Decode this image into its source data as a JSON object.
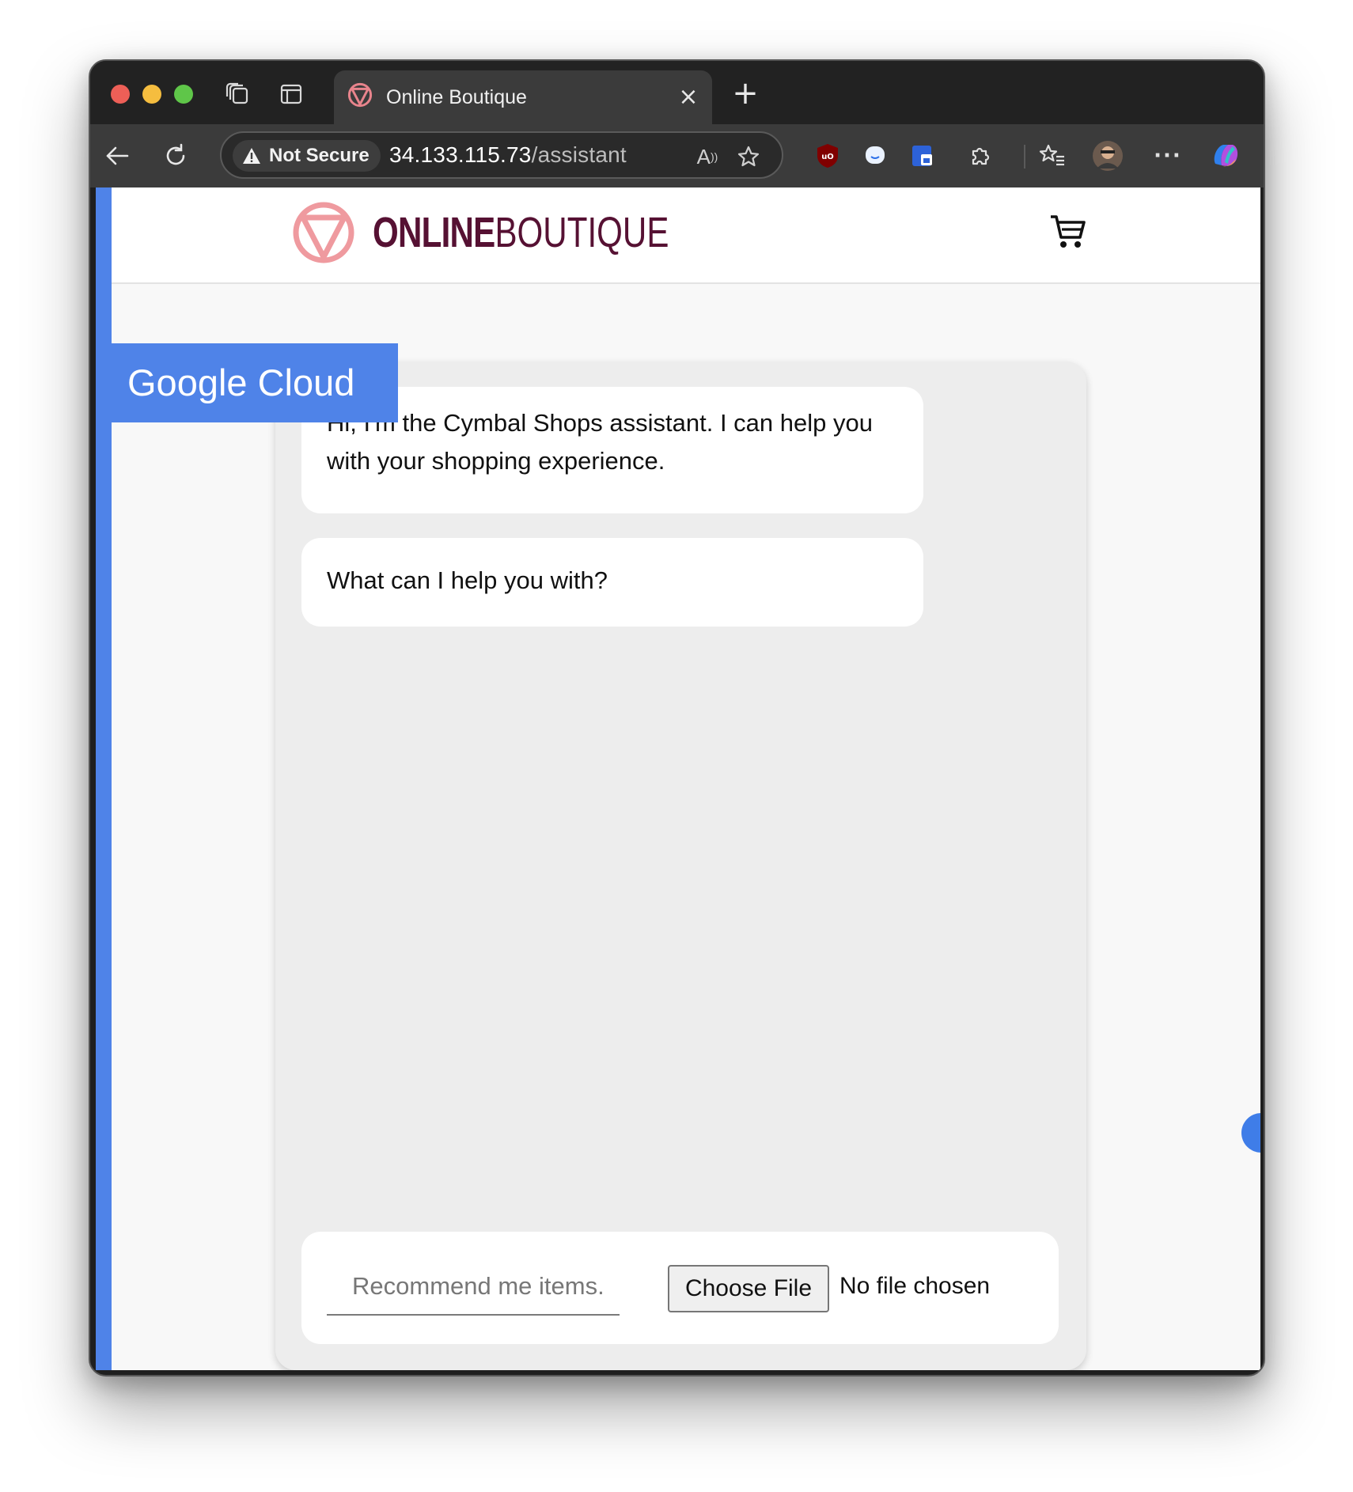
{
  "browser": {
    "tab": {
      "title": "Online Boutique"
    },
    "address_bar": {
      "security_label": "Not Secure",
      "url_host": "34.133.115.73",
      "url_path": "/assistant"
    },
    "icons": {
      "back": "arrow-left-icon",
      "reload": "reload-icon",
      "read_aloud": "read-aloud-icon",
      "favorite": "star-icon",
      "collections": "favorites-list-icon",
      "menu": "more-icon"
    }
  },
  "site": {
    "brand_bold": "ONLINE",
    "brand_light": "BOUTIQUE",
    "brand_color": "#561133",
    "accent_color": "#4f83e8"
  },
  "badge": {
    "label": "Google Cloud"
  },
  "chat": {
    "messages": [
      {
        "text": "Hi, I'm the Cymbal Shops assistant. I can help you with your shopping experience."
      },
      {
        "text": "What can I help you with?"
      }
    ],
    "input": {
      "placeholder": "Recommend me items."
    },
    "file_picker": {
      "button_label": "Choose File",
      "status": "No file chosen"
    }
  }
}
